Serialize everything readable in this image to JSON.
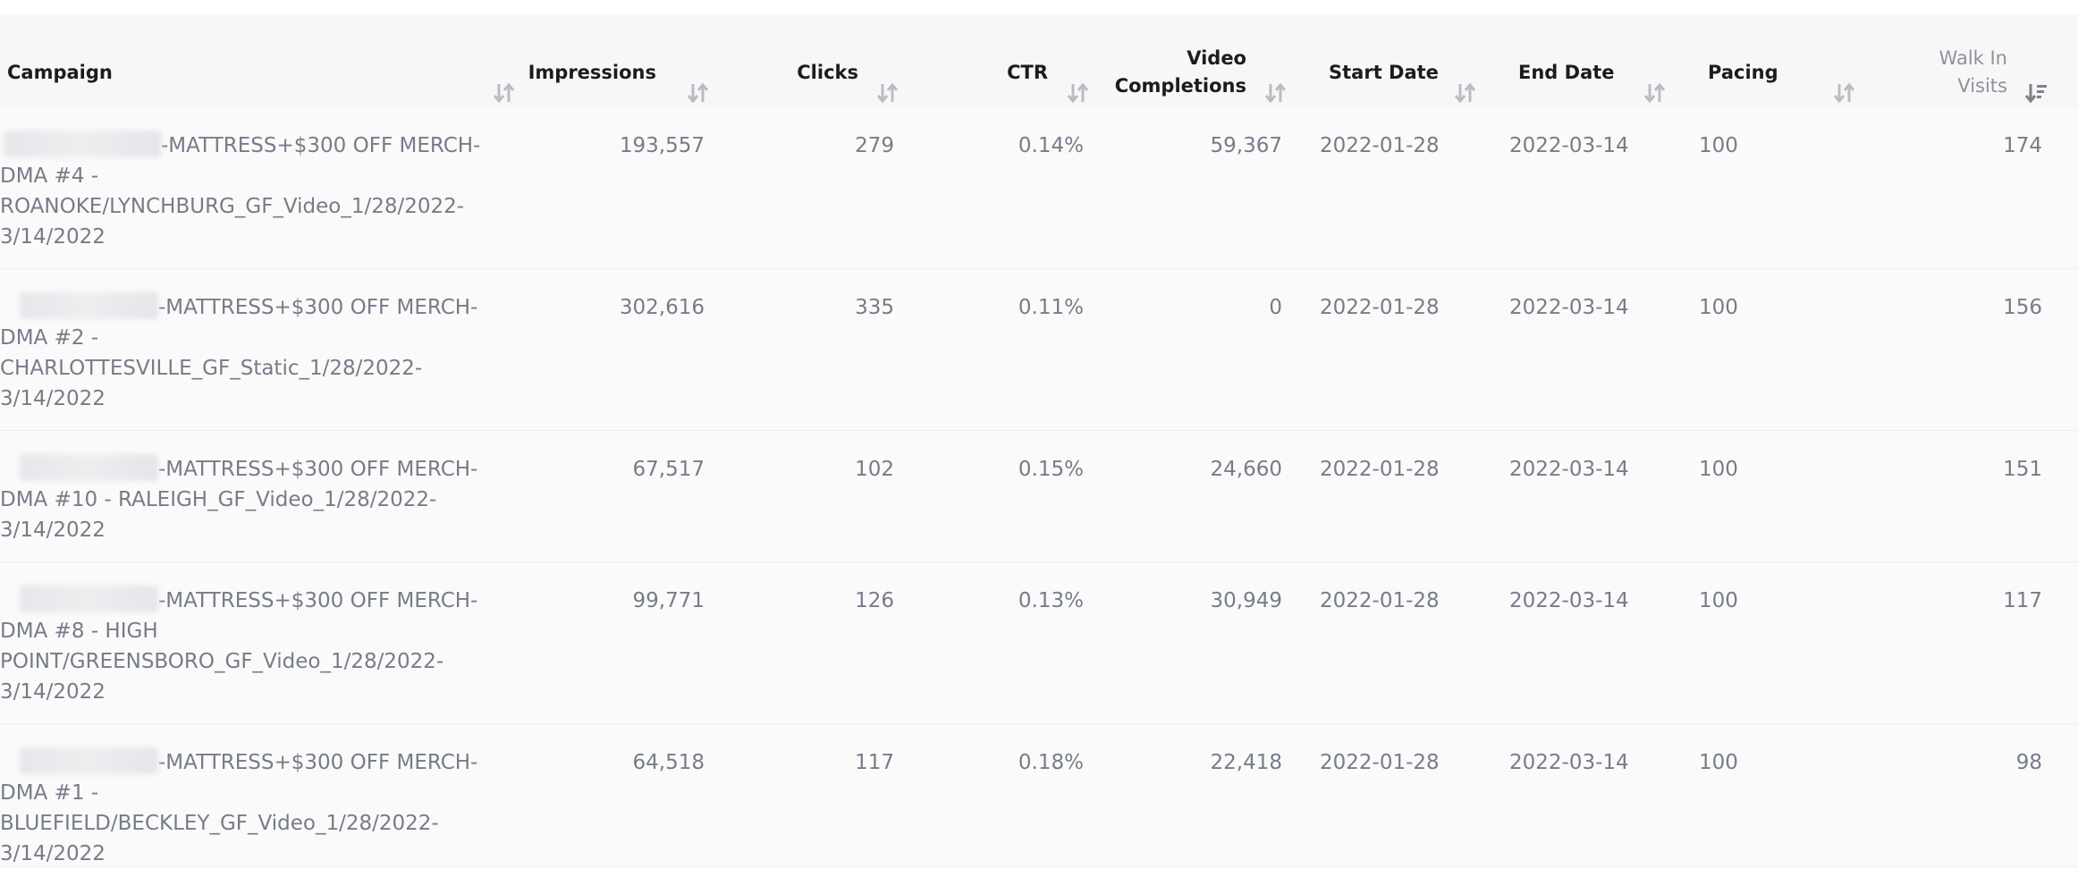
{
  "table": {
    "columns": [
      {
        "key": "campaign",
        "label_line1": "Campaign",
        "label_line2": ""
      },
      {
        "key": "impressions",
        "label_line1": "Impressions",
        "label_line2": ""
      },
      {
        "key": "clicks",
        "label_line1": "Clicks",
        "label_line2": ""
      },
      {
        "key": "ctr",
        "label_line1": "CTR",
        "label_line2": ""
      },
      {
        "key": "video_completions",
        "label_line1": "Video",
        "label_line2": "Completions"
      },
      {
        "key": "start_date",
        "label_line1": "Start Date",
        "label_line2": ""
      },
      {
        "key": "end_date",
        "label_line1": "End Date",
        "label_line2": ""
      },
      {
        "key": "pacing",
        "label_line1": "Pacing",
        "label_line2": ""
      },
      {
        "key": "walk_in_visits",
        "label_line1": "Walk In",
        "label_line2": "Visits"
      }
    ],
    "active_sort_column": "walk_in_visits",
    "active_sort_direction": "descending",
    "rows": [
      {
        "campaign": "-MATTRESS+$300 OFF MERCH-DMA #4 - ROANOKE/LYNCHBURG_GF_Video_1/28/2022-3/14/2022",
        "impressions": "193,557",
        "clicks": "279",
        "ctr": "0.14%",
        "video_completions": "59,367",
        "start_date": "2022-01-28",
        "end_date": "2022-03-14",
        "pacing": "100",
        "walk_in_visits": "174"
      },
      {
        "campaign": "-MATTRESS+$300 OFF MERCH-DMA #2 - CHARLOTTESVILLE_GF_Static_1/28/2022-3/14/2022",
        "impressions": "302,616",
        "clicks": "335",
        "ctr": "0.11%",
        "video_completions": "0",
        "start_date": "2022-01-28",
        "end_date": "2022-03-14",
        "pacing": "100",
        "walk_in_visits": "156"
      },
      {
        "campaign": "-MATTRESS+$300 OFF MERCH-DMA #10 - RALEIGH_GF_Video_1/28/2022-3/14/2022",
        "impressions": "67,517",
        "clicks": "102",
        "ctr": "0.15%",
        "video_completions": "24,660",
        "start_date": "2022-01-28",
        "end_date": "2022-03-14",
        "pacing": "100",
        "walk_in_visits": "151"
      },
      {
        "campaign": "-MATTRESS+$300 OFF MERCH-DMA #8 - HIGH POINT/GREENSBORO_GF_Video_1/28/2022-3/14/2022",
        "impressions": "99,771",
        "clicks": "126",
        "ctr": "0.13%",
        "video_completions": "30,949",
        "start_date": "2022-01-28",
        "end_date": "2022-03-14",
        "pacing": "100",
        "walk_in_visits": "117"
      },
      {
        "campaign": "-MATTRESS+$300 OFF MERCH-DMA #1 - BLUEFIELD/BECKLEY_GF_Video_1/28/2022-3/14/2022",
        "impressions": "64,518",
        "clicks": "117",
        "ctr": "0.18%",
        "video_completions": "22,418",
        "start_date": "2022-01-28",
        "end_date": "2022-03-14",
        "pacing": "100",
        "walk_in_visits": "98"
      }
    ]
  },
  "icons": {
    "sort": "sort-arrows-icon",
    "sort_active": "sort-descending-icon"
  },
  "colors": {
    "header_bg": "#f7f7f8",
    "row_bg": "#fafafa",
    "header_text": "#1c1c1f",
    "cell_text": "#767c88",
    "sort_icon": "#b9bcc3",
    "sort_icon_active": "#7d828c"
  }
}
